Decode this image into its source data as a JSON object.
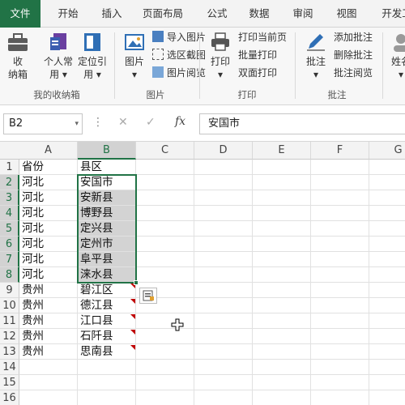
{
  "tabs": [
    "文件",
    "开始",
    "插入",
    "页面布局",
    "公式",
    "数据",
    "审阅",
    "视图",
    "开发工"
  ],
  "ribbon": {
    "groups": {
      "collect": "我的收纳箱",
      "picture": "图片",
      "print": "打印",
      "comment": "批注"
    },
    "collect_box": "收\n纳箱",
    "personal": "个人常\n用 ▾",
    "locate": "定位引\n用 ▾",
    "picture_btn": "图片\n▾",
    "import_pic": "导入图片",
    "region_shot": "选区截图",
    "pic_view": "图片阅览",
    "print_btn": "打印\n▾",
    "print_current": "打印当前页",
    "batch_print": "批量打印",
    "duplex_print": "双面打印",
    "comment_btn": "批注\n▾",
    "add_comment": "添加批注",
    "delete_comment": "删除批注",
    "view_comment": "批注阅览",
    "cut_off": "姓名\n▾"
  },
  "formula_bar": {
    "name_box": "B2",
    "dropdown": "▾",
    "dots": "⋮",
    "cancel": "✕",
    "enter": "✓",
    "fx": "fx",
    "content": "安国市"
  },
  "columns": [
    "A",
    "B",
    "C",
    "D",
    "E",
    "F",
    "G"
  ],
  "rows": [
    "1",
    "2",
    "3",
    "4",
    "5",
    "6",
    "7",
    "8",
    "9",
    "10",
    "11",
    "12",
    "13",
    "14",
    "15",
    "16"
  ],
  "sheet": {
    "A": [
      "省份",
      "河北",
      "河北",
      "河北",
      "河北",
      "河北",
      "河北",
      "河北",
      "贵州",
      "贵州",
      "贵州",
      "贵州",
      "贵州",
      "",
      "",
      ""
    ],
    "B": [
      "县区",
      "安国市",
      "安新县",
      "博野县",
      "定兴县",
      "定州市",
      "阜平县",
      "涞水县",
      "碧江区",
      "德江县",
      "江口县",
      "石阡县",
      "思南县",
      "",
      "",
      ""
    ]
  },
  "selection": "B2:B8",
  "colors": {
    "accent": "#217346",
    "comment": "#c00000"
  }
}
